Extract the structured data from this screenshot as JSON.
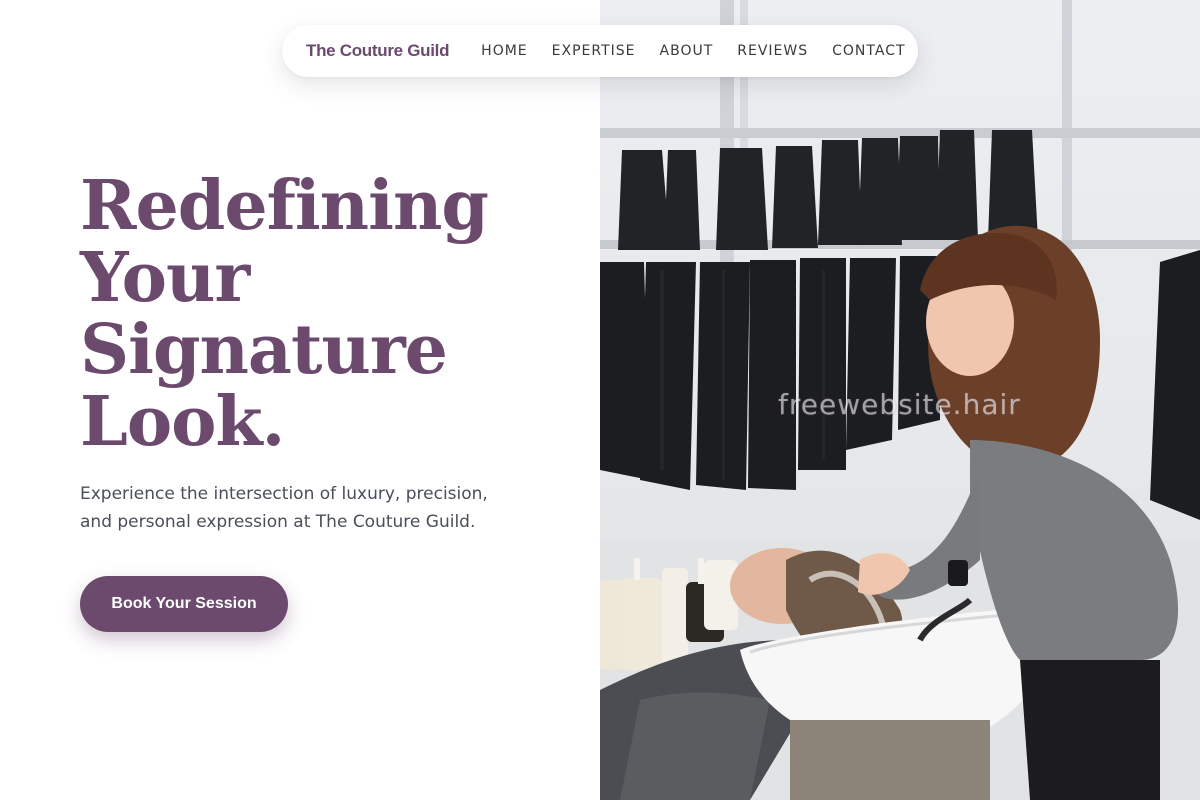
{
  "nav": {
    "brand": "The Couture Guild",
    "links": [
      "HOME",
      "EXPERTISE",
      "ABOUT",
      "REVIEWS",
      "CONTACT"
    ]
  },
  "hero": {
    "title_lines": [
      "Redefining",
      "Your",
      "Signature",
      "Look."
    ],
    "subtitle": "Experience the intersection of luxury, precision, and personal expression at The Couture Guild.",
    "cta_label": "Book Your Session"
  },
  "image": {
    "watermark": "freewebsite.hair"
  },
  "colors": {
    "brand": "#6b4a6e",
    "body_text": "#4a4f57",
    "background": "#ffffff"
  }
}
